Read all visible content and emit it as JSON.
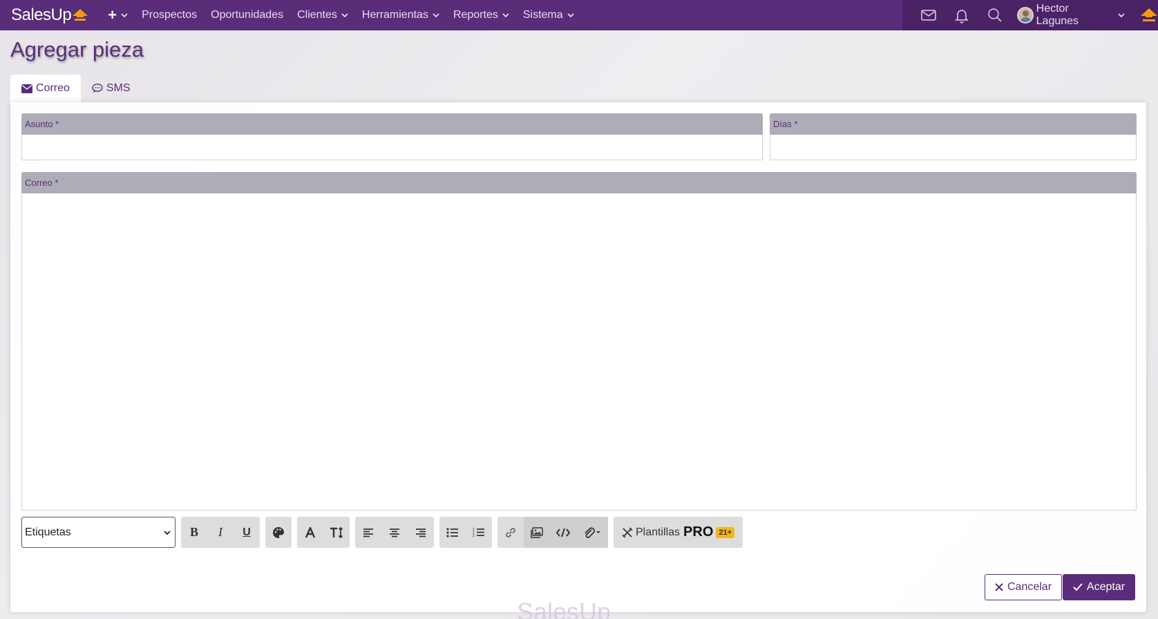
{
  "app": {
    "brand": "SalesUp",
    "watermark": "SalesUp"
  },
  "nav": {
    "items": [
      "Prospectos",
      "Oportunidades",
      "Clientes",
      "Herramientas",
      "Reportes",
      "Sistema"
    ]
  },
  "user": {
    "name": "Hector Lagunes"
  },
  "page": {
    "title": "Agregar pieza"
  },
  "tabs": [
    {
      "label": "Correo",
      "icon": "envelope-icon",
      "active": true
    },
    {
      "label": "SMS",
      "icon": "chat-icon",
      "active": false
    }
  ],
  "form": {
    "subject_label": "Asunto *",
    "subject_value": "",
    "days_label": "Días *",
    "days_value": "",
    "email_label": "Correo *"
  },
  "toolbar": {
    "tags_select": "Etiquetas",
    "templates_label": "Plantillas",
    "templates_pro": "PRO",
    "templates_badge": "21+"
  },
  "actions": {
    "cancel": "Cancelar",
    "accept": "Aceptar"
  },
  "colors": {
    "brand_purple": "#5a2d7a",
    "accent_orange": "#f39c12",
    "badge_yellow": "#f3b619"
  }
}
